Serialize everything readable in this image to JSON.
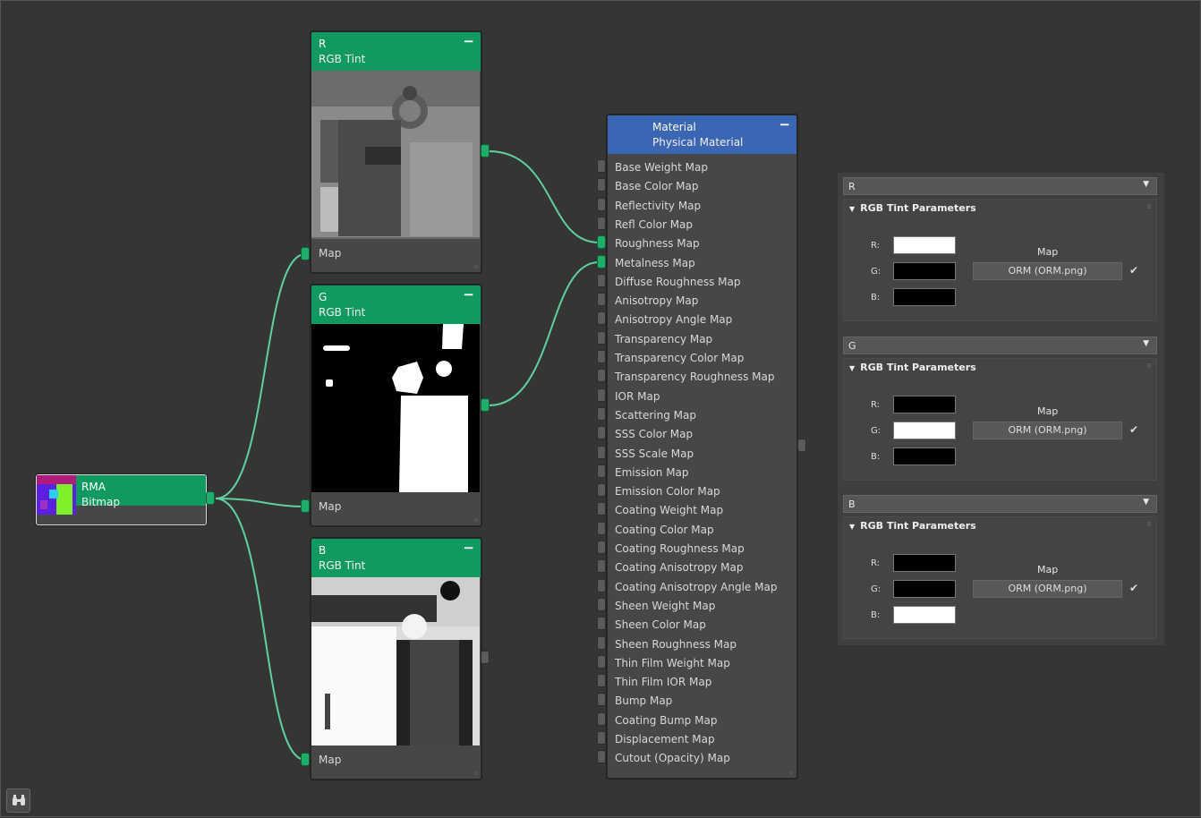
{
  "nodes": {
    "r": {
      "title": "R",
      "subtitle": "RGB Tint",
      "port": "Map"
    },
    "g": {
      "title": "G",
      "subtitle": "RGB Tint",
      "port": "Map"
    },
    "b": {
      "title": "B",
      "subtitle": "RGB Tint",
      "port": "Map"
    },
    "rma": {
      "title": "RMA",
      "subtitle": "Bitmap"
    },
    "material": {
      "title": "Material",
      "subtitle": "Physical Material",
      "slots": [
        "Base Weight Map",
        "Base Color Map",
        "Reflectivity Map",
        "Refl Color Map",
        "Roughness Map",
        "Metalness Map",
        "Diffuse Roughness Map",
        "Anisotropy Map",
        "Anisotropy Angle Map",
        "Transparency Map",
        "Transparency Color Map",
        "Transparency Roughness Map",
        "IOR Map",
        "Scattering Map",
        "SSS Color Map",
        "SSS Scale Map",
        "Emission Map",
        "Emission Color Map",
        "Coating Weight Map",
        "Coating Color Map",
        "Coating Roughness Map",
        "Coating Anisotropy Map",
        "Coating Anisotropy Angle Map",
        "Sheen Weight Map",
        "Sheen Color Map",
        "Sheen Roughness Map",
        "Thin Film Weight Map",
        "Thin Film IOR Map",
        "Bump Map",
        "Coating Bump Map",
        "Displacement Map",
        "Cutout (Opacity) Map"
      ]
    }
  },
  "panel": {
    "rollouts": [
      {
        "name": "R",
        "params_title": "RGB Tint Parameters",
        "labels": [
          "R:",
          "G:",
          "B:"
        ],
        "colors": [
          "#ffffff",
          "#000000",
          "#000000"
        ],
        "map_label": "Map",
        "map_button": "ORM (ORM.png)",
        "checked": "✔"
      },
      {
        "name": "G",
        "params_title": "RGB Tint Parameters",
        "labels": [
          "R:",
          "G:",
          "B:"
        ],
        "colors": [
          "#000000",
          "#ffffff",
          "#000000"
        ],
        "map_label": "Map",
        "map_button": "ORM (ORM.png)",
        "checked": "✔"
      },
      {
        "name": "B",
        "params_title": "RGB Tint Parameters",
        "labels": [
          "R:",
          "G:",
          "B:"
        ],
        "colors": [
          "#000000",
          "#000000",
          "#ffffff"
        ],
        "map_label": "Map",
        "map_button": "ORM (ORM.png)",
        "checked": "✔"
      }
    ]
  },
  "colors": {
    "node_header_green": "#119a5f",
    "material_header_blue": "#3a66b3",
    "wire": "#5fd0a0",
    "background": "#353535"
  },
  "icons": {
    "collapse": "−",
    "dropdown": "▼",
    "collapse_arrow": "▼",
    "checkbox": "✔",
    "nav": "binoculars-icon"
  }
}
